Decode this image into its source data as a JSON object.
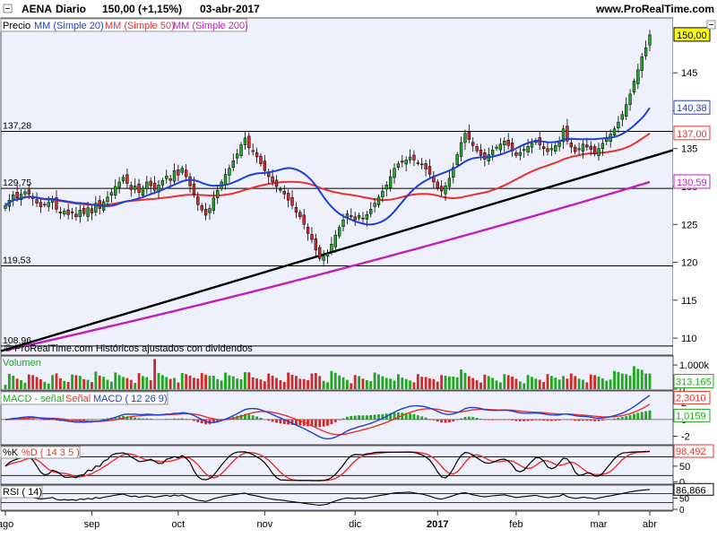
{
  "header": {
    "symbol": "AENA",
    "period": "Diario",
    "quote": "150,00 (+1,15%)",
    "date": "03-abr-2017",
    "site": "www.ProRealTime.com"
  },
  "legend": {
    "price": "Precio",
    "ma20": "MM (Simple 20)",
    "ma50": "MM (Simple 50)",
    "ma200": "MM (Simple 200)"
  },
  "copyright": "© ProRealTime.com  Históricos ajustados con dividendos",
  "colors": {
    "ma20": "#1f3fd6",
    "ma50": "#e8312e",
    "ma200": "#c01fc0",
    "trend": "#000000",
    "up": "#22a722",
    "down": "#d12a2a",
    "panel_bg": "#eef0fb"
  },
  "chart_data": [
    {
      "type": "candlestick",
      "name": "price",
      "x": [
        "ago",
        "sep",
        "oct",
        "nov",
        "dic",
        "2017",
        "feb",
        "mar",
        "abr"
      ],
      "ylim": [
        108,
        152
      ],
      "y_ticks": [
        110,
        115,
        120,
        125,
        130,
        135,
        140,
        145
      ],
      "y_tick_labels": [
        "110",
        "115",
        "120",
        "125",
        "130",
        "135",
        "140",
        "145"
      ],
      "levels": [
        {
          "label": "137,28",
          "value": 137.28
        },
        {
          "label": "129,75",
          "value": 129.75
        },
        {
          "label": "119,53",
          "value": 119.53
        },
        {
          "label": "108,96",
          "value": 108.96
        }
      ],
      "last_values": [
        {
          "label": "150,00",
          "value": 150.0
        },
        {
          "label": "140,38",
          "value": 140.38
        },
        {
          "label": "137,00",
          "value": 137.0
        },
        {
          "label": "130,59",
          "value": 130.59
        }
      ],
      "close": [
        127.5,
        128.2,
        128.9,
        128.5,
        129.0,
        129.3,
        129.0,
        128.4,
        127.8,
        127.3,
        127.6,
        127.9,
        128.3,
        127.0,
        126.5,
        126.8,
        126.3,
        126.6,
        126.0,
        126.9,
        126.4,
        127.2,
        126.5,
        127.8,
        127.1,
        128.0,
        128.6,
        129.2,
        130.0,
        130.6,
        131.2,
        130.4,
        129.6,
        130.1,
        129.2,
        129.8,
        130.6,
        130.1,
        129.5,
        130.2,
        130.8,
        131.4,
        130.8,
        132.1,
        131.5,
        132.4,
        131.3,
        130.1,
        129.0,
        127.6,
        126.9,
        126.2,
        127.1,
        128.5,
        129.5,
        130.6,
        131.6,
        132.4,
        133.4,
        134.3,
        135.5,
        136.4,
        135.1,
        134.6,
        133.9,
        133.0,
        132.1,
        131.3,
        130.6,
        130.0,
        129.5,
        129.0,
        128.2,
        127.5,
        126.6,
        126.0,
        125.0,
        123.8,
        123.0,
        121.6,
        120.5,
        120.8,
        121.2,
        122.4,
        123.6,
        124.6,
        125.6,
        126.4,
        126.0,
        125.6,
        126.2,
        125.8,
        126.3,
        127.0,
        127.8,
        128.6,
        129.4,
        130.2,
        131.3,
        132.4,
        133.0,
        133.2,
        133.5,
        133.9,
        133.5,
        133.1,
        132.9,
        132.3,
        131.6,
        130.6,
        129.8,
        129.4,
        130.1,
        131.1,
        132.5,
        134.2,
        135.8,
        137.0,
        136.2,
        135.4,
        134.7,
        134.1,
        133.6,
        134.2,
        134.8,
        135.2,
        135.6,
        136.0,
        135.4,
        134.7,
        134.1,
        134.5,
        134.9,
        135.3,
        135.7,
        136.1,
        135.5,
        135.0,
        134.6,
        135.0,
        135.4,
        135.8,
        137.6,
        136.0,
        135.2,
        134.6,
        135.0,
        135.6,
        135.2,
        134.9,
        134.3,
        135.0,
        135.7,
        136.3,
        136.9,
        137.6,
        138.5,
        139.5,
        140.8,
        142.2,
        143.9,
        145.4,
        147.1,
        148.3,
        150.0
      ],
      "ma20_last": 140.38,
      "ma50_last": 137.0,
      "ma200_last": 130.59
    },
    {
      "type": "bar",
      "name": "volume",
      "label": "Volumen",
      "y_tick_labels": [
        "1.000k",
        "0"
      ],
      "last_value": "313.165",
      "ylim": [
        0,
        1300
      ]
    },
    {
      "type": "line",
      "name": "macd",
      "label_a": "MACD - señal",
      "label_b": "Señal",
      "label_c": "MACD ( 12 26 9)",
      "y_ticks": [
        2,
        0,
        -2
      ],
      "y_tick_labels": [
        "2",
        "0",
        "-2"
      ],
      "last_values": [
        "2,3010",
        "1,0159"
      ],
      "ylim": [
        -2.8,
        3.2
      ]
    },
    {
      "type": "line",
      "name": "stochastic",
      "label_a": "%K",
      "label_b": "%D ( 14 3 5 )",
      "y_ticks": [
        100,
        50,
        0
      ],
      "y_tick_labels": [
        "100",
        "50",
        "0"
      ],
      "last_value": "98,492",
      "ylim": [
        -5,
        110
      ]
    },
    {
      "type": "line",
      "name": "rsi",
      "label": "RSI ( 14)",
      "y_tick_labels": [
        "100",
        "50",
        "0"
      ],
      "last_value": "86,866",
      "ylim": [
        0,
        100
      ]
    }
  ],
  "x_axis": {
    "labels": [
      {
        "text": "ago",
        "bold": false
      },
      {
        "text": "sep",
        "bold": false
      },
      {
        "text": "oct",
        "bold": false
      },
      {
        "text": "nov",
        "bold": false
      },
      {
        "text": "dic",
        "bold": false
      },
      {
        "text": "2017",
        "bold": true
      },
      {
        "text": "feb",
        "bold": false
      },
      {
        "text": "mar",
        "bold": false
      },
      {
        "text": "abr",
        "bold": false
      }
    ]
  }
}
